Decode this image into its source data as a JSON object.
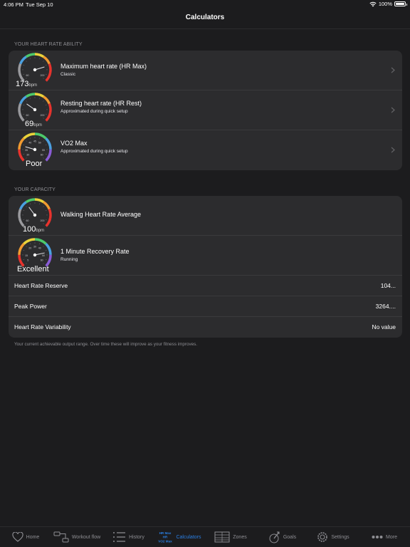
{
  "status_bar": {
    "time": "4:06 PM",
    "date": "Tue Sep 10",
    "battery": "100%"
  },
  "nav": {
    "title": "Calculators"
  },
  "section1": {
    "header": "YOUR HEART RATE ABILITY",
    "rows": [
      {
        "title": "Maximum heart rate (HR Max)",
        "subtitle": "Classic",
        "value": "173",
        "unit": "bpm",
        "gauge_min": "60",
        "gauge_max": "200"
      },
      {
        "title": "Resting heart rate (HR Rest)",
        "subtitle": "Approximated during quick setup",
        "value": "69",
        "unit": "bpm",
        "gauge_min": "60",
        "gauge_max": "200"
      },
      {
        "title": "VO2 Max",
        "subtitle": "Approximated during quick setup",
        "value": "Poor",
        "unit": "",
        "gauge_min": "30",
        "gauge_max": "60"
      }
    ]
  },
  "section2": {
    "header": "YOUR CAPACITY",
    "rows": [
      {
        "title": "Walking Heart Rate Average",
        "subtitle": "",
        "value": "100",
        "unit": "bpm",
        "gauge_min": "60",
        "gauge_max": "200"
      },
      {
        "title": "1 Minute Recovery Rate",
        "subtitle": "Running",
        "value": "Excellent",
        "unit": "",
        "gauge_min": "5",
        "gauge_max": "60"
      }
    ],
    "simple_rows": [
      {
        "label": "Heart Rate Reserve",
        "value": "104..."
      },
      {
        "label": "Peak Power",
        "value": "3264...."
      },
      {
        "label": "Heart Rate Variability",
        "value": "No value"
      }
    ],
    "footer": "Your current achievable output range. Over time these will improve as your fitness improves."
  },
  "tabs": [
    {
      "label": "Home",
      "icon": "heart-icon"
    },
    {
      "label": "Workout flow",
      "icon": "workout-flow-icon"
    },
    {
      "label": "History",
      "icon": "history-list-icon"
    },
    {
      "label": "Calculators",
      "icon": "calculators-icon",
      "icon_text_top": "HR Max",
      "icon_text_mid": "HR",
      "icon_text_bottom": "VO2 Max"
    },
    {
      "label": "Zones",
      "icon": "zones-icon"
    },
    {
      "label": "Goals",
      "icon": "goals-icon"
    },
    {
      "label": "Settings",
      "icon": "settings-gear-icon"
    },
    {
      "label": "More",
      "icon": "more-dots-icon"
    }
  ],
  "colors": {
    "background": "#1c1c1e",
    "card": "#2c2c2e",
    "accent": "#2a7fe3",
    "secondary_text": "#8e8e93"
  }
}
